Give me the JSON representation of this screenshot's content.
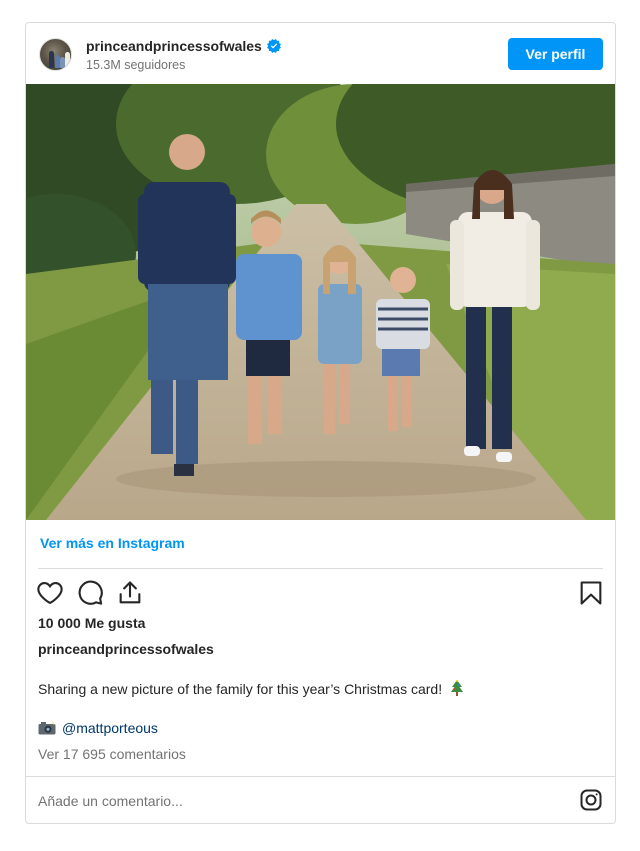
{
  "header": {
    "username": "princeandprincessofwales",
    "followers": "15.3M seguidores",
    "profile_button": "Ver perfil",
    "avatar_icon": "profile-avatar",
    "verified_icon": "verified-badge-icon",
    "accent_color": "#0095f6"
  },
  "post": {
    "photo_subject": "family-photo",
    "view_more": "Ver más en Instagram",
    "actions": {
      "like_icon": "heart-icon",
      "comment_icon": "comment-icon",
      "share_icon": "share-icon",
      "save_icon": "bookmark-icon"
    },
    "likes": "10 000 Me gusta",
    "owner": "princeandprincessofwales",
    "caption": "Sharing a new picture of the family for this year’s Christmas card!",
    "caption_emoji_icon": "christmas-tree-icon",
    "credit_icon": "camera-flash-icon",
    "credit_mention": "@mattporteous",
    "comments_link": "Ver 17 695 comentarios"
  },
  "comment_box": {
    "placeholder": "Añade un comentario...",
    "instagram_icon": "instagram-icon"
  }
}
